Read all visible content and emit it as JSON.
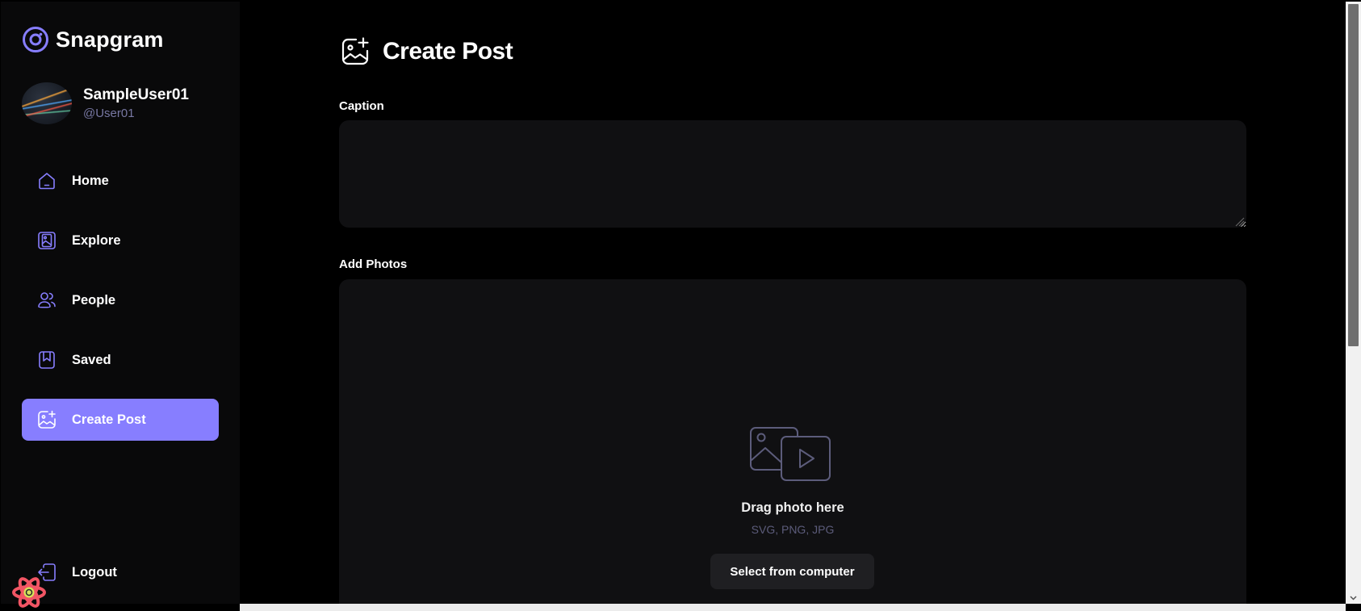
{
  "app": {
    "name": "Snapgram",
    "accent_color": "#877eff",
    "logo_icon": "camera-lens-icon"
  },
  "user": {
    "name": "SampleUser01",
    "handle": "@User01"
  },
  "sidebar": {
    "items": [
      {
        "label": "Home",
        "icon": "home-icon",
        "active": false
      },
      {
        "label": "Explore",
        "icon": "gallery-icon",
        "active": false
      },
      {
        "label": "People",
        "icon": "people-icon",
        "active": false
      },
      {
        "label": "Saved",
        "icon": "bookmark-icon",
        "active": false
      },
      {
        "label": "Create Post",
        "icon": "gallery-add-icon",
        "active": true
      }
    ],
    "logout_label": "Logout"
  },
  "page": {
    "title": "Create Post",
    "caption_label": "Caption",
    "caption_value": "",
    "photos_label": "Add Photos",
    "dropzone": {
      "title": "Drag photo here",
      "formats": "SVG, PNG, JPG",
      "button_label": "Select from computer"
    }
  }
}
